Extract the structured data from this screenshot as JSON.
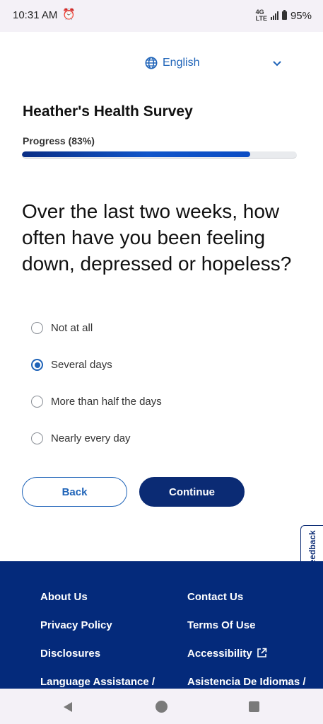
{
  "status": {
    "time": "10:31 AM",
    "network": "4G LTE",
    "battery": "95%"
  },
  "language": {
    "label": "English"
  },
  "survey": {
    "title": "Heather's Health Survey",
    "progress_label": "Progress (83%)",
    "progress_fraction": 0.83
  },
  "question": "Over the last two weeks, how often have you been feeling down, depressed or hopeless?",
  "options": [
    {
      "label": "Not at all",
      "selected": false
    },
    {
      "label": "Several days",
      "selected": true
    },
    {
      "label": "More than half the days",
      "selected": false
    },
    {
      "label": "Nearly every day",
      "selected": false
    }
  ],
  "buttons": {
    "back": "Back",
    "continue": "Continue"
  },
  "feedback": "Feedback",
  "footer": {
    "about": "About Us",
    "contact": "Contact Us",
    "privacy": "Privacy Policy",
    "terms": "Terms Of Use",
    "disclosures": "Disclosures",
    "accessibility": "Accessibility",
    "language_assistance": "Language Assistance /",
    "asistencia": "Asistencia De Idiomas /"
  },
  "colors": {
    "primary": "#0b2b74",
    "link": "#1e63b8",
    "footer_bg": "#042a7b"
  }
}
